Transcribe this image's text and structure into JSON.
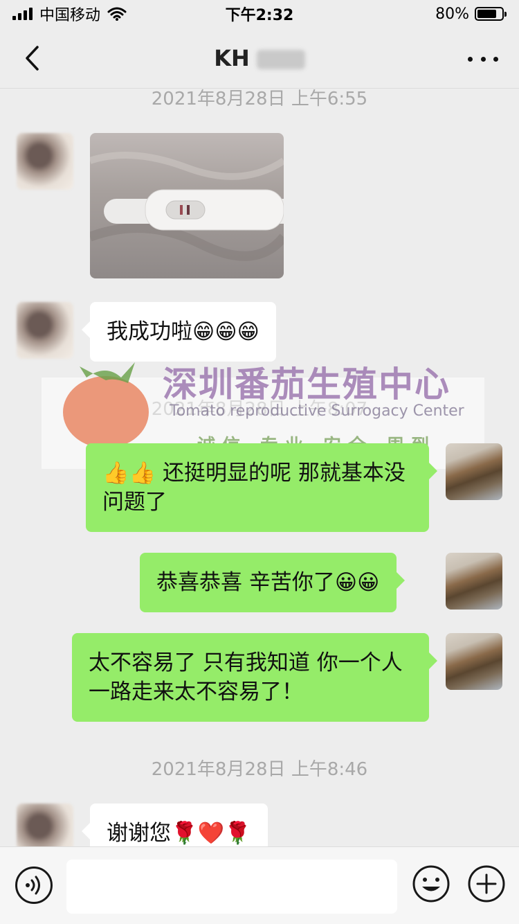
{
  "status_bar": {
    "carrier": "中国移动",
    "time": "下午2:32",
    "battery": "80%",
    "battery_level": 0.8
  },
  "nav": {
    "title": "KH"
  },
  "messages": [
    {
      "type": "timestamp",
      "text": "2021年8月28日 上午6:55"
    },
    {
      "type": "image",
      "sender": "contact"
    },
    {
      "type": "text",
      "sender": "contact",
      "text": "我成功啦😁😁😁"
    },
    {
      "type": "timestamp",
      "text": "2021年8月28日 上午8:07"
    },
    {
      "type": "text",
      "sender": "me",
      "text": "👍👍 还挺明显的呢 那就基本没问题了"
    },
    {
      "type": "text",
      "sender": "me",
      "text": "恭喜恭喜 辛苦你了😀😀"
    },
    {
      "type": "text",
      "sender": "me",
      "text": "太不容易了 只有我知道 你一个人一路走来太不容易了！"
    },
    {
      "type": "timestamp",
      "text": "2021年8月28日 上午8:46"
    },
    {
      "type": "text",
      "sender": "contact",
      "text": "谢谢您🌹❤️🌹"
    }
  ],
  "watermark": {
    "title": "深圳番茄生殖中心",
    "subtitle": "Tomato reproductive Surrogacy Center",
    "slogan": "诚信 专业 安全 周到"
  },
  "input_bar": {
    "input_value": "",
    "voice_icon": "voice-icon",
    "emoji_icon": "emoji-icon",
    "plus_icon": "plus-icon"
  },
  "colors": {
    "background": "#ededed",
    "bubble_me": "#95ec69",
    "bubble_contact": "#ffffff",
    "timestamp": "#a8a8a8"
  }
}
